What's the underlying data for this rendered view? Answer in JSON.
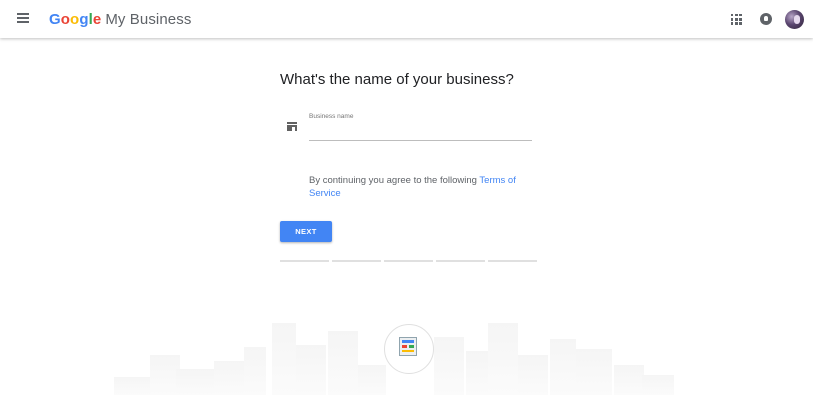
{
  "header": {
    "logo_google": [
      "G",
      "o",
      "o",
      "g",
      "l",
      "e"
    ],
    "product_name": "My Business",
    "icons": [
      "menu-icon",
      "apps-grid-icon",
      "notifications-icon",
      "account-avatar"
    ]
  },
  "form": {
    "question": "What's the name of your business?",
    "field_label": "Business name",
    "field_value": "",
    "field_icon": "store-icon",
    "terms_text": "By continuing you agree to the following ",
    "terms_link": "Terms of Service",
    "next_label": "NEXT",
    "progress_steps": 5,
    "progress_current": 0
  },
  "illustration": {
    "icon": "storefront-sign-icon"
  },
  "colors": {
    "accent": "#4285f4",
    "google_blue": "#4285f4",
    "google_red": "#ea4335",
    "google_yellow": "#fbbc05",
    "google_green": "#34a853"
  }
}
